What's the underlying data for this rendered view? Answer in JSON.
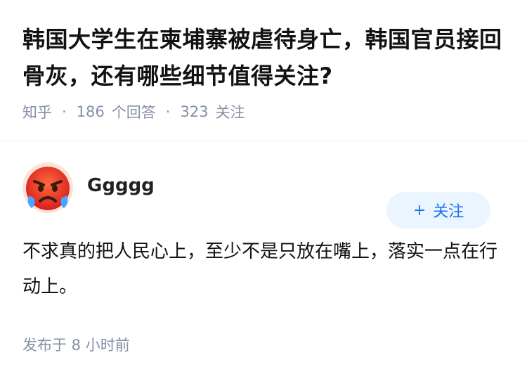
{
  "question": {
    "title": "韩国大学生在柬埔寨被虐待身亡，韩国官员接回骨灰，还有哪些细节值得关注?",
    "source": "知乎",
    "answers_count": "186",
    "answers_label": "个回答",
    "followers_count": "323",
    "followers_label": "关注"
  },
  "answer": {
    "author_name": "Ggggg",
    "avatar_icon": "angry-face-emoji-icon",
    "follow_label": "关注",
    "content": "不求真的把人民心上，至少不是只放在嘴上，落实一点在行动上。",
    "published": "发布于  8 小时前"
  },
  "colors": {
    "accent": "#1772f6",
    "follow_bg": "#ebf5ff",
    "meta_text": "#8590a6"
  }
}
